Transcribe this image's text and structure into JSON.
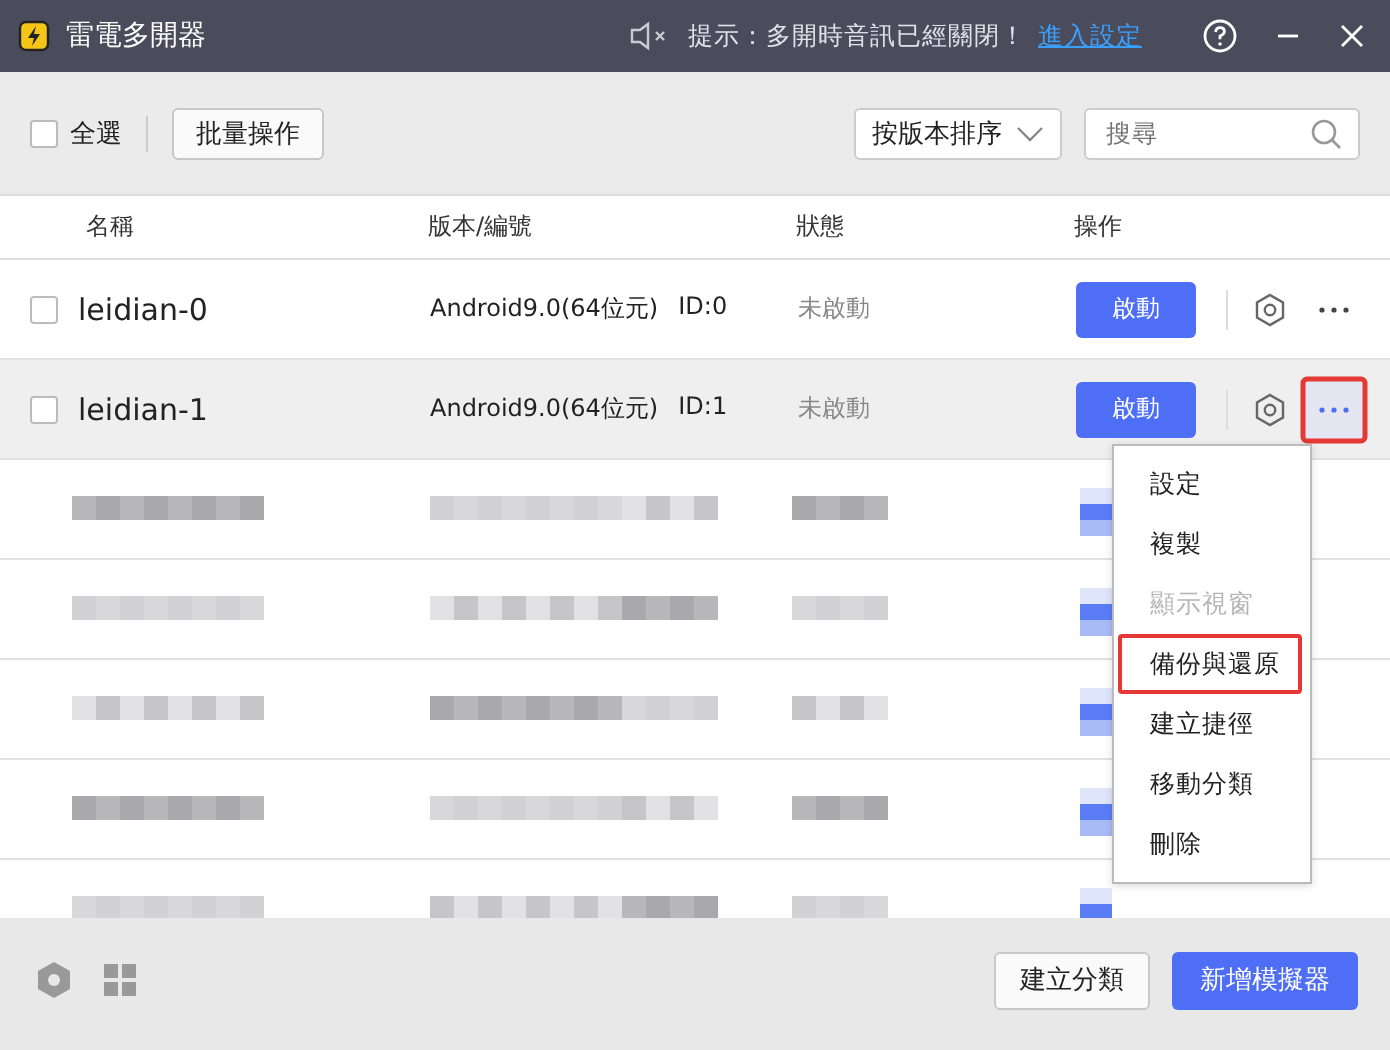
{
  "window": {
    "title": "雷電多開器"
  },
  "notice": {
    "muted": true,
    "text": "提示：多開時音訊已經關閉！",
    "link": "進入設定"
  },
  "toolbar": {
    "select_all": {
      "label": "全選",
      "checked": false
    },
    "batch_button": "批量操作",
    "sort": {
      "value": "按版本排序"
    },
    "search": {
      "placeholder": "搜尋"
    }
  },
  "table": {
    "columns": [
      "名稱",
      "版本/編號",
      "狀態",
      "操作"
    ],
    "rows": [
      {
        "kind": "emulator",
        "name": "leidian-0",
        "version": "Android9.0(64位元)",
        "id": "ID:0",
        "status": "未啟動",
        "action": "啟動",
        "checked": false,
        "hovered": false,
        "more_highlighted": false
      },
      {
        "kind": "emulator",
        "name": "leidian-1",
        "version": "Android9.0(64位元)",
        "id": "ID:1",
        "status": "未啟動",
        "action": "啟動",
        "checked": false,
        "hovered": true,
        "more_highlighted": true
      },
      {
        "kind": "redacted"
      },
      {
        "kind": "redacted"
      },
      {
        "kind": "redacted"
      },
      {
        "kind": "redacted"
      },
      {
        "kind": "redacted"
      }
    ]
  },
  "context_menu": {
    "items": [
      {
        "label": "設定",
        "disabled": false,
        "highlighted": false
      },
      {
        "label": "複製",
        "disabled": false,
        "highlighted": false
      },
      {
        "label": "顯示視窗",
        "disabled": true,
        "highlighted": false
      },
      {
        "label": "備份與還原",
        "disabled": false,
        "highlighted": true
      },
      {
        "label": "建立捷徑",
        "disabled": false,
        "highlighted": false
      },
      {
        "label": "移動分類",
        "disabled": false,
        "highlighted": false
      },
      {
        "label": "刪除",
        "disabled": false,
        "highlighted": false
      }
    ]
  },
  "footer": {
    "buttons": [
      "建立分類",
      "新增模擬器"
    ]
  }
}
